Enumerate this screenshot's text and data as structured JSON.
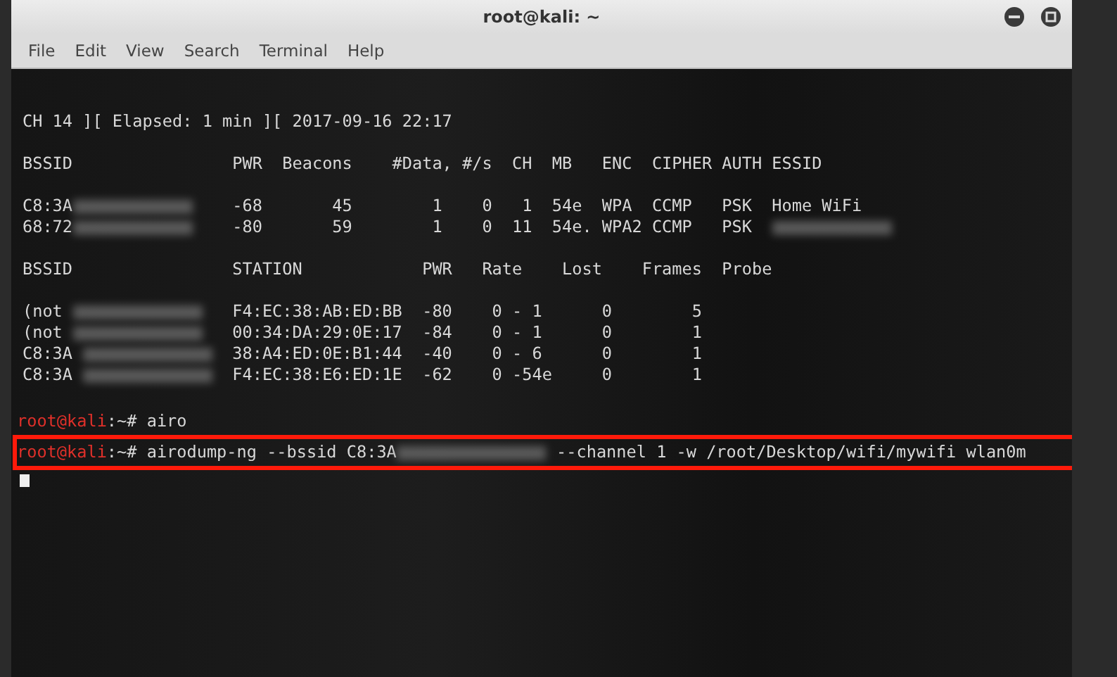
{
  "window": {
    "title": "root@kali: ~"
  },
  "menu": [
    "File",
    "Edit",
    "View",
    "Search",
    "Terminal",
    "Help"
  ],
  "terminal": {
    "status_line": "CH 14 ][ Elapsed: 1 min ][ 2017-09-16 22:17",
    "ap_header": "BSSID                PWR  Beacons    #Data, #/s  CH  MB   ENC  CIPHER AUTH ESSID",
    "access_points": [
      {
        "bssid": "C8:3A",
        "fields": "    -68       45        1    0   1  54e  WPA  CCMP   PSK  ",
        "essid": "Home WiFi",
        "essid_hidden": false
      },
      {
        "bssid": "68:72",
        "fields": "    -80       59        1    0  11  54e. WPA2 CCMP   PSK  ",
        "essid_hidden": true
      }
    ],
    "station_header": "BSSID                STATION            PWR   Rate    Lost    Frames  Probe",
    "stations": [
      {
        "bssid": "(not",
        "fields": "  F4:EC:38:AB:ED:BB  -80    0 - 1      0        5"
      },
      {
        "bssid": "(not",
        "fields": "  00:34:DA:29:0E:17  -84    0 - 1      0        1"
      },
      {
        "bssid": "C8:3A",
        "fields": "  38:A4:ED:0E:B1:44  -40    0 - 6      0        1"
      },
      {
        "bssid": "C8:3A",
        "fields": "  F4:EC:38:E6:ED:1E  -62    0 -54e     0        1"
      }
    ],
    "prompts": [
      {
        "user": "root@kali",
        "path": ":~#",
        "command": "airo",
        "highlighted": false
      },
      {
        "user": "root@kali",
        "path": ":~#",
        "command": "airodump-ng --bssid C8:3A",
        "tail": "--channel 1 -w /root/Desktop/wifi/mywifi wlan0m",
        "highlighted": true
      }
    ]
  }
}
